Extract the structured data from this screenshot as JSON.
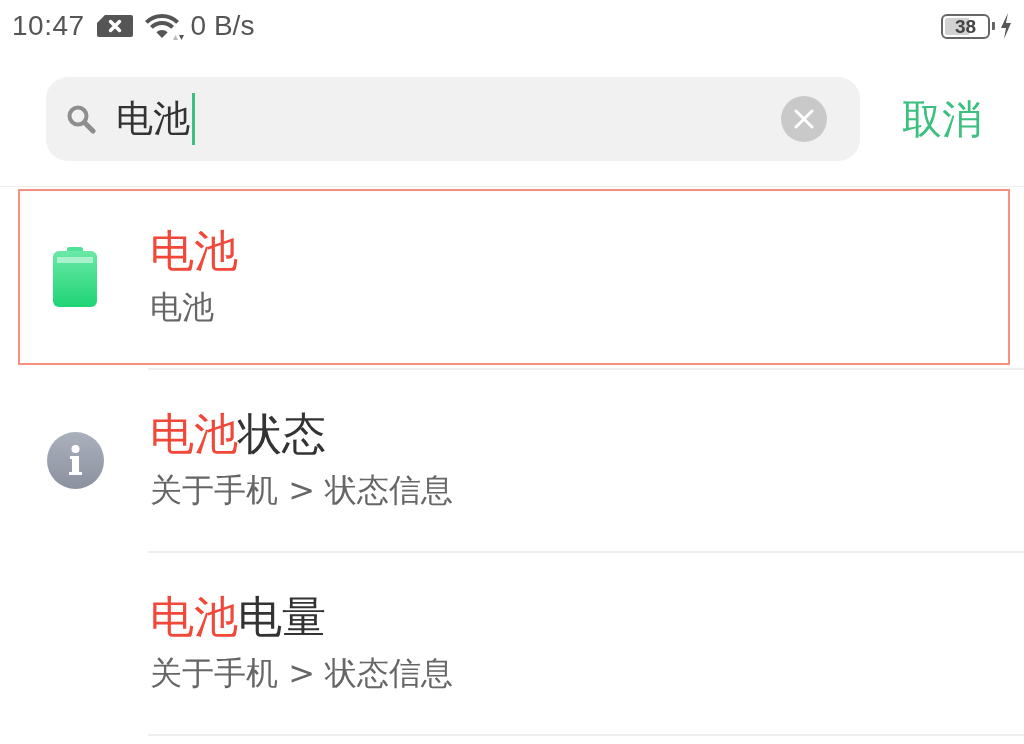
{
  "status_bar": {
    "time": "10:47",
    "network_speed": "0 B/s",
    "battery": "38",
    "charging": true
  },
  "search": {
    "value": "电池",
    "cancel": "取消"
  },
  "results": [
    {
      "kind": "battery",
      "title": [
        {
          "text": "电池",
          "highlighted": true
        }
      ],
      "subtitle": "电池",
      "selected": true
    },
    {
      "kind": "info",
      "title": [
        {
          "text": "电池",
          "highlighted": true
        },
        {
          "text": "状态",
          "highlighted": false
        }
      ],
      "subtitle": "关于手机 > 状态信息",
      "selected": false
    },
    {
      "kind": "plain",
      "title": [
        {
          "text": "电池",
          "highlighted": true
        },
        {
          "text": "电量",
          "highlighted": false
        }
      ],
      "subtitle": "关于手机 > 状态信息",
      "selected": false
    }
  ]
}
